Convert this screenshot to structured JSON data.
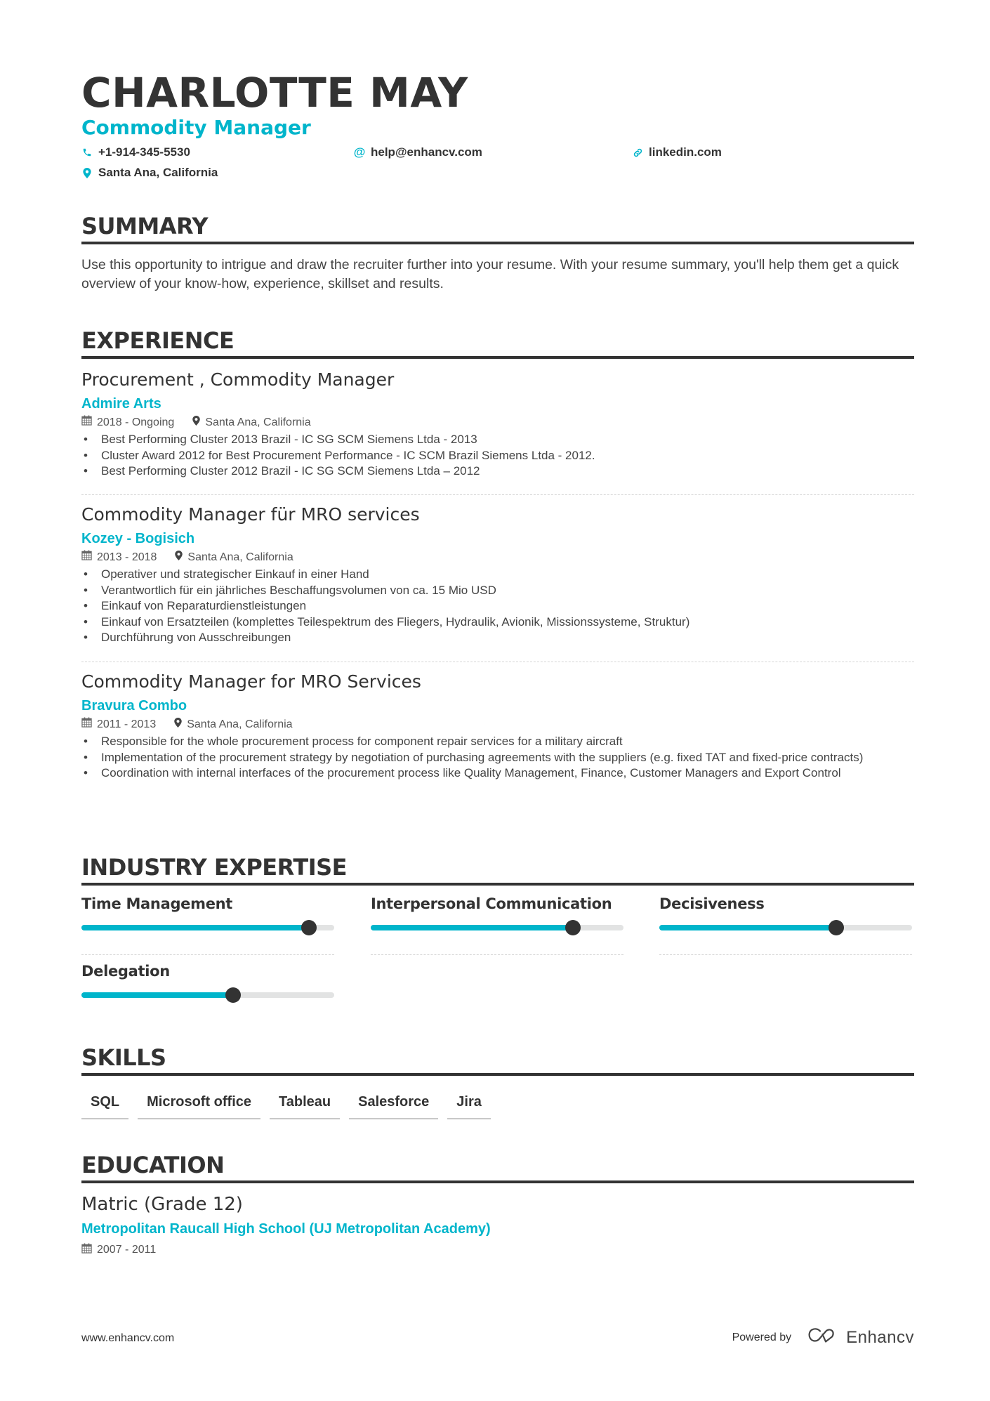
{
  "header": {
    "name": "CHARLOTTE MAY",
    "title": "Commodity Manager",
    "phone": "+1-914-345-5530",
    "email": "help@enhancv.com",
    "website": "linkedin.com",
    "location": "Santa Ana, California",
    "icons": {
      "phone": "phone-icon",
      "email": "at-icon",
      "website": "link-icon",
      "location": "map-pin-icon"
    }
  },
  "colors": {
    "accent": "#00b5cb",
    "text": "#333333",
    "track": "#e2e3e3",
    "knob": "#333333"
  },
  "summary": {
    "heading": "SUMMARY",
    "text": "Use this opportunity to intrigue and draw the recruiter further into your resume. With your resume summary, you'll help them get a quick overview of your know-how, experience, skillset and results."
  },
  "experience": {
    "heading": "EXPERIENCE",
    "items": [
      {
        "role": "Procurement , Commodity Manager",
        "company": "Admire Arts",
        "dates": "2018 - Ongoing",
        "location": "Santa Ana, California",
        "bullets": [
          "Best Performing Cluster 2013 Brazil -  IC SG SCM Siemens Ltda - 2013",
          "Cluster Award 2012 for Best Procurement Performance -  IC SCM Brazil Siemens Ltda - 2012.",
          "Best Performing Cluster 2012 Brazil -  IC SG SCM Siemens Ltda – 2012"
        ]
      },
      {
        "role": "Commodity Manager für MRO services",
        "company": "Kozey - Bogisich",
        "dates": "2013 - 2018",
        "location": "Santa Ana, California",
        "bullets": [
          "Operativer und strategischer Einkauf in einer Hand",
          "Verantwortlich für ein jährliches Beschaffungsvolumen von ca. 15 Mio USD",
          "Einkauf von Reparaturdienstleistungen",
          "Einkauf von Ersatzteilen (komplettes Teilespektrum des Fliegers, Hydraulik, Avionik, Missionssysteme, Struktur)",
          "Durchführung von Ausschreibungen"
        ]
      },
      {
        "role": "Commodity Manager for MRO Services",
        "company": "Bravura Combo",
        "dates": "2011 - 2013",
        "location": "Santa Ana, California",
        "bullets": [
          "Responsible for the whole procurement process for component repair services for a military aircraft",
          "Implementation of the procurement strategy by negotiation of purchasing agreements with the suppliers (e.g. fixed TAT and fixed-price contracts)",
          "Coordination with internal interfaces of the procurement process like Quality Management, Finance, Customer Managers and Export Control"
        ]
      }
    ]
  },
  "expertise": {
    "heading": "INDUSTRY EXPERTISE",
    "items": [
      {
        "label": "Time Management",
        "level": 0.9
      },
      {
        "label": "Interpersonal Communication",
        "level": 0.8
      },
      {
        "label": "Decisiveness",
        "level": 0.7
      },
      {
        "label": "Delegation",
        "level": 0.6
      }
    ]
  },
  "skills": {
    "heading": "SKILLS",
    "items": [
      "SQL",
      "Microsoft office",
      "Tableau",
      "Salesforce",
      "Jira"
    ]
  },
  "education": {
    "heading": "EDUCATION",
    "degree": "Matric (Grade 12)",
    "school": "Metropolitan Raucall High School (UJ Metropolitan Academy)",
    "dates": "2007 - 2011"
  },
  "footer": {
    "website": "www.enhancv.com",
    "powered_by": "Powered by",
    "brand": "Enhancv"
  }
}
